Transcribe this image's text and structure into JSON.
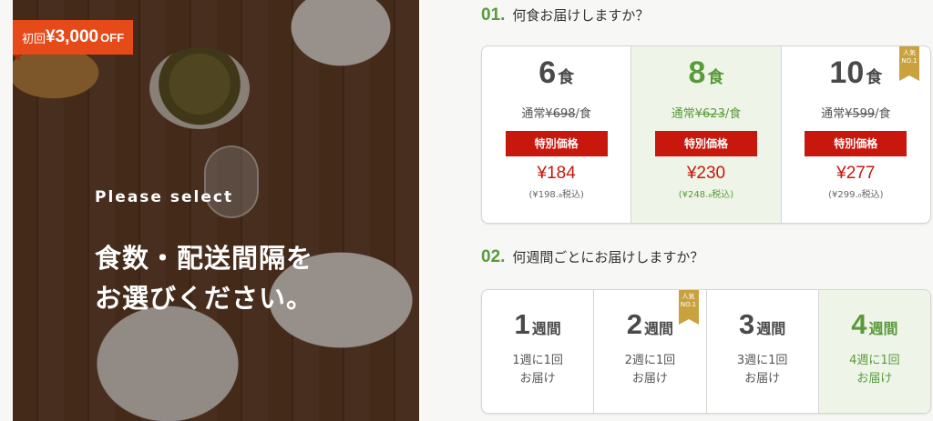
{
  "hero": {
    "badge_prefix": "初回",
    "badge_amount": "¥3,000",
    "badge_suffix": "OFF",
    "subtitle": "Please select",
    "title_line1": "食数・配送間隔を",
    "title_line2": "お選びください。"
  },
  "section1": {
    "num": "01.",
    "heading": "何食お届けしますか？",
    "popular_label_1": "人気",
    "popular_label_2": "NO.1",
    "special_label": "特別価格",
    "options": [
      {
        "count": "6",
        "unit": "食",
        "regular_prefix": "通常",
        "regular_price": "¥698",
        "regular_suffix": "/食",
        "price": "¥184",
        "tax": "(¥198.₈税込)",
        "selected": false
      },
      {
        "count": "8",
        "unit": "食",
        "regular_prefix": "通常",
        "regular_price": "¥623",
        "regular_suffix": "/食",
        "price": "¥230",
        "tax": "(¥248.₈税込)",
        "selected": true
      },
      {
        "count": "10",
        "unit": "食",
        "regular_prefix": "通常",
        "regular_price": "¥599",
        "regular_suffix": "/食",
        "price": "¥277",
        "tax": "(¥299.₀税込)",
        "selected": false
      }
    ]
  },
  "section2": {
    "num": "02.",
    "heading": "何週間ごとにお届けしますか？",
    "popular_label_1": "人気",
    "popular_label_2": "NO.1",
    "options": [
      {
        "count": "1",
        "unit": "週間",
        "line1": "1週に1回",
        "line2": "お届け",
        "selected": false
      },
      {
        "count": "2",
        "unit": "週間",
        "line1": "2週に1回",
        "line2": "お届け",
        "selected": false
      },
      {
        "count": "3",
        "unit": "週間",
        "line1": "3週に1回",
        "line2": "お届け",
        "selected": false
      },
      {
        "count": "4",
        "unit": "週間",
        "line1": "4週に1回",
        "line2": "お届け",
        "selected": true
      }
    ]
  },
  "colors": {
    "accent_green": "#5a9a3c",
    "price_red": "#c8170d",
    "badge_orange": "#e64a19",
    "ribbon_gold": "#c9a23f"
  }
}
